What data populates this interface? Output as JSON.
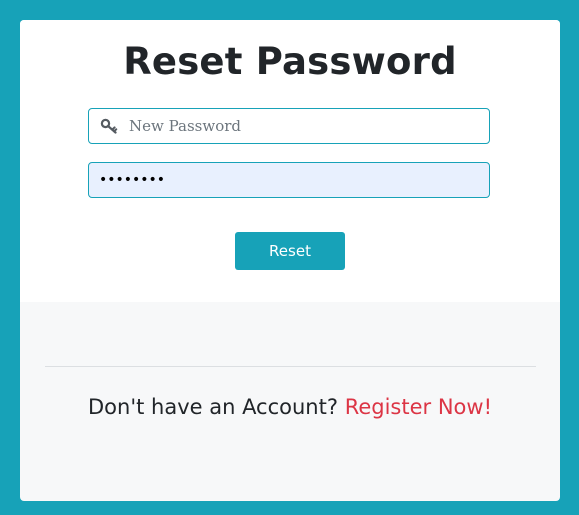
{
  "colors": {
    "background": "#17a2b8",
    "accent": "#17a2b8",
    "link": "#dc3545",
    "autofill_field": "#e8f0fe"
  },
  "form": {
    "title": "Reset Password",
    "new_password": {
      "placeholder": "New Password",
      "value": "",
      "icon": "key-icon"
    },
    "confirm_password": {
      "value": "••••••••"
    },
    "reset_label": "Reset"
  },
  "footer": {
    "prompt_text": "Don't have an Account?",
    "register_link": "Register Now!"
  }
}
